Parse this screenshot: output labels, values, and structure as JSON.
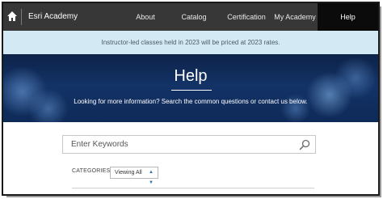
{
  "nav": {
    "brand": "Esri Academy",
    "items": [
      {
        "label": "About"
      },
      {
        "label": "Catalog"
      },
      {
        "label": "Certification"
      },
      {
        "label": "My Academy"
      },
      {
        "label": "Help",
        "active": true
      }
    ],
    "home_icon": "home-icon"
  },
  "notice": "Instructor-led classes held in 2023 will be priced at 2023 rates.",
  "hero": {
    "title": "Help",
    "subtitle": "Looking for more information? Search the common questions or contact us below."
  },
  "search": {
    "placeholder": "Enter Keywords",
    "icon": "search-icon"
  },
  "filter": {
    "label": "CATEGORIES",
    "selected": "Viewing All"
  },
  "colors": {
    "nav_bg": "#373737",
    "nav_active": "#0b0b0b",
    "notice_bg": "#d3e9f4",
    "hero_bg": "#133266"
  }
}
